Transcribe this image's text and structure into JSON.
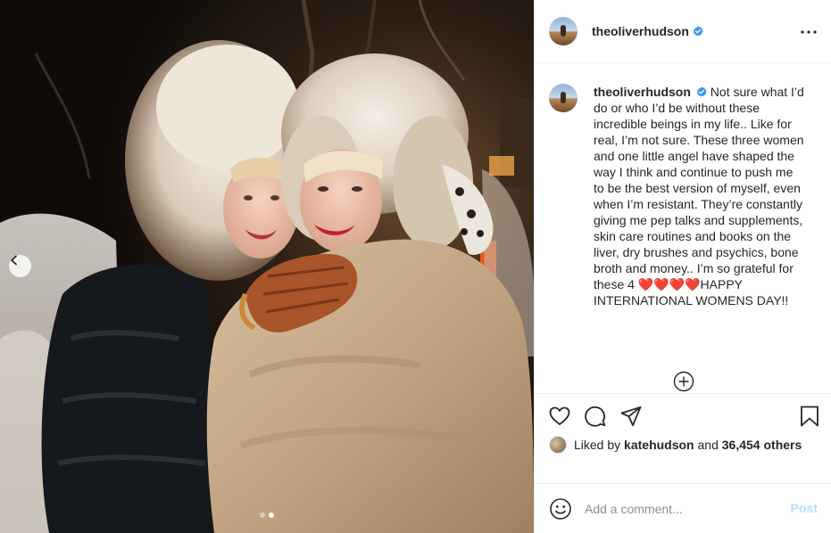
{
  "post": {
    "username": "theoliverhudson",
    "verified": true,
    "more_icon": "more-horizontal-icon",
    "caption": "Not sure what I’d do or who I’d be without these incredible beings in my life.. Like for real, I’m not sure. These three women and one little angel have shaped the way I think and continue to push me to be the best version of myself, even when I’m resistant. They’re constantly giving me pep talks and supplements, skin care routines and books on the liver, dry brushes and psychics, bone broth and money.. I’m so grateful for these 4 ❤️❤️❤️❤️HAPPY INTERNATIONAL WOMENS DAY!!",
    "likes": {
      "prefix": "Liked by",
      "user": "katehudson",
      "connector": "and",
      "others": "36,454 others"
    }
  },
  "actions": {
    "like_icon": "heart-icon",
    "comment_icon": "comment-icon",
    "share_icon": "paper-plane-icon",
    "save_icon": "bookmark-icon",
    "load_more_icon": "plus-circle-icon"
  },
  "comment": {
    "placeholder": "Add a comment...",
    "post_label": "Post",
    "emoji_icon": "smiley-icon"
  },
  "carousel": {
    "prev_icon": "chevron-left-icon",
    "slides": 2,
    "active_slide": 2
  },
  "colors": {
    "verified_blue": "#3897f0",
    "post_button_disabled": "#b2dffc",
    "border": "#efefef"
  }
}
